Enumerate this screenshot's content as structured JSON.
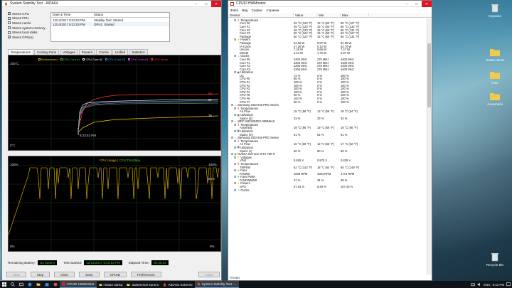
{
  "aida": {
    "title": "System Stability Test - AIDA64",
    "checks": [
      {
        "label": "Stress CPU",
        "checked": true
      },
      {
        "label": "Stress FPU",
        "checked": false
      },
      {
        "label": "Stress cache",
        "checked": false
      },
      {
        "label": "Stress system memory",
        "checked": false
      },
      {
        "label": "Stress local disks",
        "checked": false
      },
      {
        "label": "Stress GPU(s)",
        "checked": true
      }
    ],
    "table": {
      "col_date": "Date & Time",
      "col_status": "Status",
      "rows": [
        {
          "date": "12/14/2017 8:23:53 PM",
          "status": "Stability Test: Started"
        },
        {
          "date": "12/14/2017 8:23:53 PM",
          "status": "GPU1: Started"
        }
      ]
    },
    "tabs": [
      "Temperatures",
      "Cooling Fans",
      "Voltages",
      "Powers",
      "Clocks",
      "Unified",
      "Statistics"
    ],
    "graph1": {
      "legend": [
        "Motherboard",
        "CPU Core #1",
        "CPU Core #2",
        "CPU Core #3",
        "CPU Core #4",
        "GPU Diode"
      ],
      "legend_colors": [
        "#f2c200",
        "#44cc44",
        "#ffffff",
        "#33aaff",
        "#ff55ff",
        "#ff3333"
      ],
      "ymax": "100°C",
      "ymin": "0°C",
      "time": "8:23:53 PM",
      "right_labels": [
        "62",
        "57",
        "36"
      ]
    },
    "graph2": {
      "title_a": "CPU Usage",
      "title_b": "CPU Throttling",
      "ymax_left": "100%",
      "ymin_left": "0%",
      "right_top": "100%",
      "right_mid": "83%",
      "right_bot": "0%"
    },
    "status": {
      "battery_label": "Remaining Battery:",
      "battery_value": "No battery",
      "started_label": "Test Started:",
      "started_value": "12/14/2017 8:23:53 PM",
      "elapsed_label": "Elapsed Time:",
      "elapsed_value": "00:06:04"
    },
    "buttons": {
      "start": "Start",
      "stop": "Stop",
      "clear": "Clear",
      "save": "Save",
      "cpuid": "CPUID",
      "preferences": "Preferences",
      "close": "Close"
    }
  },
  "hwm": {
    "title": "CPUID HWMonitor",
    "menu": [
      "Файл",
      "Вид",
      "Сервис",
      "Справка"
    ],
    "cols": [
      "Sensor",
      "Value",
      "Min",
      "Max"
    ],
    "rows": [
      {
        "n": "Temperatures",
        "lvl": 2,
        "g": "temp"
      },
      {
        "n": "Core #0",
        "lvl": 4,
        "v": "49 °C (120 °F)",
        "mn": "16 °C (60 °F)",
        "mx": "55 °C (127 °F)"
      },
      {
        "n": "Core #1",
        "lvl": 4,
        "v": "49 °C (120 °F)",
        "mn": "16 °C (60 °F)",
        "mx": "56 °C (132 °F)"
      },
      {
        "n": "Core #2",
        "lvl": 4,
        "v": "49 °C (120 °F)",
        "mn": "16 °C (60 °F)",
        "mx": "55 °C (131 °F)"
      },
      {
        "n": "Core #3",
        "lvl": 4,
        "v": "50 °C (122 °F)",
        "mn": "16 °C (60 °F)",
        "mx": "53 °C (127 °F)"
      },
      {
        "n": "Package",
        "lvl": 4,
        "v": "50 °C (122 °F)",
        "mn": "16 °C (60 °F)",
        "mx": "55 °C (131 °F)"
      },
      {
        "n": "Powers",
        "lvl": 2,
        "g": "power"
      },
      {
        "n": "Package",
        "lvl": 4,
        "v": "54.62 W",
        "mn": "0.87 W",
        "mx": "61.09 W"
      },
      {
        "n": "IA Cores",
        "lvl": 4,
        "v": "47.20 W",
        "mn": "0.12 W",
        "mx": "53.70 W"
      },
      {
        "n": "Uncore",
        "lvl": 4,
        "v": "7.28 W",
        "mn": "0.65 W",
        "mx": "7.47 W"
      },
      {
        "n": "DRAM",
        "lvl": 4,
        "v": "2.44 W",
        "mn": "1.72 W",
        "mx": "2.87 W"
      },
      {
        "n": "Clocks",
        "lvl": 2,
        "g": "clock"
      },
      {
        "n": "Core #0",
        "lvl": 4,
        "v": "4200 MHz",
        "mn": "275 MHz",
        "mx": "4400 MHz"
      },
      {
        "n": "Core #1",
        "lvl": 4,
        "v": "4200 MHz",
        "mn": "275 MHz",
        "mx": "4400 MHz"
      },
      {
        "n": "Core #2",
        "lvl": 4,
        "v": "4200 MHz",
        "mn": "275 MHz",
        "mx": "4400 MHz"
      },
      {
        "n": "Core #3",
        "lvl": 4,
        "v": "4200 MHz",
        "mn": "275 MHz",
        "mx": "4400 MHz"
      },
      {
        "n": "Utilization",
        "lvl": 2,
        "g": "util"
      },
      {
        "n": "UC",
        "lvl": 4,
        "v": "73 %",
        "mn": "0 %",
        "mx": "100 %"
      },
      {
        "n": "CPU #0",
        "lvl": 4,
        "v": "95 %",
        "mn": "0 %",
        "mx": "100 %"
      },
      {
        "n": "CPU #1",
        "lvl": 4,
        "v": "100 %",
        "mn": "0 %",
        "mx": "100 %"
      },
      {
        "n": "CPU #2",
        "lvl": 4,
        "v": "100 %",
        "mn": "0 %",
        "mx": "100 %"
      },
      {
        "n": "CPU #3",
        "lvl": 4,
        "v": "100 %",
        "mn": "0 %",
        "mx": "100 %"
      },
      {
        "n": "CPU #4",
        "lvl": 4,
        "v": "100 %",
        "mn": "0 %",
        "mx": "100 %"
      },
      {
        "n": "CPU #5",
        "lvl": 4,
        "v": "96 %",
        "mn": "0 %",
        "mx": "100 %"
      },
      {
        "n": "CPU #6",
        "lvl": 4,
        "v": "100 %",
        "mn": "0 %",
        "mx": "100 %"
      },
      {
        "n": "CPU #7",
        "lvl": 4,
        "v": "96 %",
        "mn": "0 %",
        "mx": "100 %"
      },
      {
        "n": "Samsung SSD 840 PRO Series",
        "lvl": 1,
        "g": "disk"
      },
      {
        "n": "Temperatures",
        "lvl": 2,
        "g": "temp"
      },
      {
        "n": "Air Flow",
        "lvl": 4,
        "v": "15 °C (59 °F)",
        "mn": "13 °C (55 °F)",
        "mx": "18 °C (64 °F)"
      },
      {
        "n": "Utilization",
        "lvl": 2,
        "g": "util"
      },
      {
        "n": "Space (d)",
        "lvl": 4,
        "v": "33 %",
        "mn": "33 %",
        "mx": "33 %"
      },
      {
        "n": "WDC WD10EZEX-00BN5A0",
        "lvl": 1,
        "g": "disk"
      },
      {
        "n": "Temperatures",
        "lvl": 2,
        "g": "temp"
      },
      {
        "n": "Assembly",
        "lvl": 4,
        "v": "19 °C (66 °F)",
        "mn": "19 °C (66 °F)",
        "mx": "19 °C (66 °F)"
      },
      {
        "n": "Utilization",
        "lvl": 2,
        "g": "util"
      },
      {
        "n": "Space (m)",
        "lvl": 4,
        "v": "61 %",
        "mn": "61 %",
        "mx": "61 %"
      },
      {
        "n": "Samsung SSD 840 PRO Series",
        "lvl": 1,
        "g": "disk"
      },
      {
        "n": "Temperatures",
        "lvl": 2,
        "g": "temp"
      },
      {
        "n": "Air Flow",
        "lvl": 4,
        "v": "16 °C (60 °F)",
        "mn": "13 °C (55 °F)",
        "mx": "17 °C (62 °F)"
      },
      {
        "n": "Utilization",
        "lvl": 2,
        "g": "util"
      },
      {
        "n": "Space (c)",
        "lvl": 4,
        "v": "60 %",
        "mn": "60 %",
        "mx": "60 %"
      },
      {
        "n": "NVIDIA GeForce GTX 780 Ti",
        "lvl": 1,
        "g": "gpu"
      },
      {
        "n": "Voltages",
        "lvl": 2,
        "g": "volt"
      },
      {
        "n": "VIN0",
        "lvl": 4,
        "v": "0.825 V",
        "mn": "0.875 V",
        "mx": "0.825 V"
      },
      {
        "n": "Temperatures",
        "lvl": 2,
        "g": "temp"
      },
      {
        "n": "TMPIN0",
        "lvl": 4,
        "v": "62 °C (143 °F)",
        "mn": "18 °C (64 °F)",
        "mx": "65 °C (149 °F)"
      },
      {
        "n": "Fans",
        "lvl": 2,
        "g": "fan"
      },
      {
        "n": "FANIN0",
        "lvl": 4,
        "v": "1608 RPM",
        "mn": "1064 RPM",
        "mx": "1773 RPM"
      },
      {
        "n": "Fans PWM",
        "lvl": 2,
        "g": "fan"
      },
      {
        "n": "FANPWMIN0",
        "lvl": 4,
        "v": "37 %",
        "mn": "34 %",
        "mx": "38 %"
      },
      {
        "n": "Powers",
        "lvl": 2,
        "g": "power"
      },
      {
        "n": "GPU",
        "lvl": 4,
        "v": "37.91 %",
        "mn": "5.49 %",
        "mx": "107.43 %"
      },
      {
        "n": "Clocks",
        "lvl": 2,
        "g": "clock"
      }
    ],
    "status": "Готово"
  },
  "desktop_icons": [
    {
      "label": "Корзина",
      "icon": "recycle-bin-icon"
    },
    {
      "label": "Новая папка",
      "icon": "folder-icon"
    },
    {
      "label": "Foto",
      "icon": "folder-icon"
    },
    {
      "label": "Ансаговок",
      "icon": "folder-icon"
    },
    {
      "label": "Recycle Bin",
      "icon": "recycle-bin-icon"
    }
  ],
  "taskbar": {
    "items": [
      {
        "label": "CPUID HWMonitor",
        "active": true
      },
      {
        "label": "Новая папка",
        "active": false
      },
      {
        "label": "Заявление конкто",
        "active": false
      },
      {
        "label": "AIDA64 Extreme",
        "active": false
      },
      {
        "label": "System Stability Test -...",
        "active": true
      }
    ],
    "lang": "ENG",
    "time": "8:42 PM"
  }
}
